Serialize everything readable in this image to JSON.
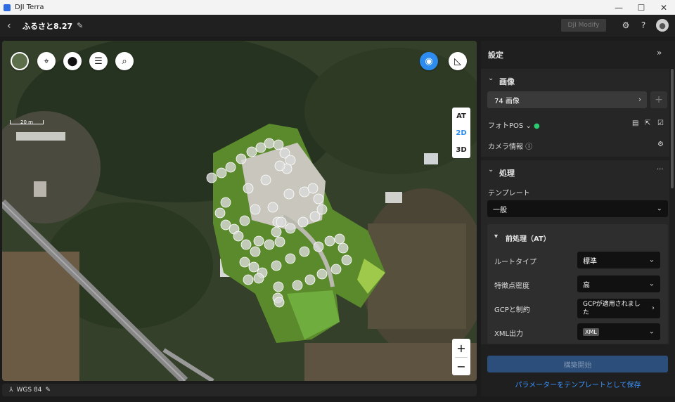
{
  "window": {
    "title": "DJI Terra"
  },
  "header": {
    "project_name": "ふるさと8.27",
    "modify_label": "DJI Modify"
  },
  "map": {
    "scale_label": "20 m",
    "view_modes": [
      "AT",
      "2D",
      "3D"
    ],
    "active_view": "2D",
    "zoom_in": "+",
    "zoom_out": "−",
    "coordinate_system": "WGS 84"
  },
  "panel": {
    "title": "設定",
    "image_section": {
      "title": "画像",
      "image_count_label": "74 画像",
      "photo_pos_label": "フォトPOS",
      "camera_info_label": "カメラ情報"
    },
    "processing_section": {
      "title": "処理",
      "template_label": "テンプレート",
      "template_value": "一般",
      "preprocess": {
        "title": "前処理（AT）",
        "route_type_label": "ルートタイプ",
        "route_type_value": "標準",
        "feature_density_label": "特徴点密度",
        "feature_density_value": "高",
        "gcp_label": "GCPと制約",
        "gcp_value": "GCPが適用されました",
        "xml_label": "XML出力",
        "xml_value": "XML"
      }
    },
    "start_button": "構築開始",
    "save_template_link": "パラメーターをテンプレートとして保存"
  },
  "colors": {
    "accent": "#2e8cf0",
    "check_green": "#2ecc71",
    "panel_bg": "#1f1f1f"
  }
}
